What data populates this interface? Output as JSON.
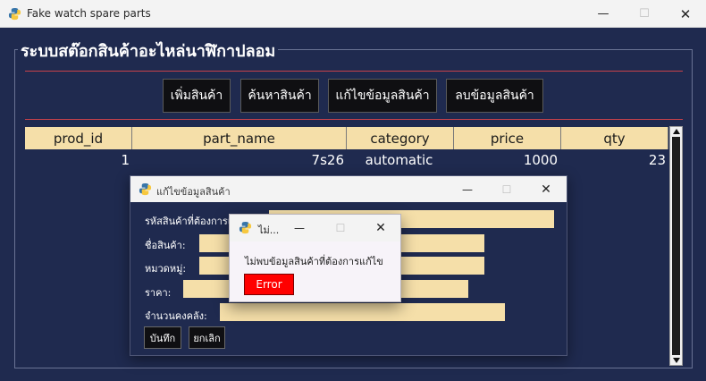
{
  "window": {
    "title": "Fake watch spare parts",
    "icon": "python-icon",
    "controls": {
      "minimize": "—",
      "maximize": "☐",
      "close": "✕"
    }
  },
  "frame": {
    "title": "ระบบสต๊อกสินค้าอะไหล่นาฬิกาปลอม"
  },
  "toolbar": {
    "add_label": "เพิ่มสินค้า",
    "search_label": "ค้นหาสินค้า",
    "edit_label": "แก้ไขข้อมูลสินค้า",
    "delete_label": "ลบข้อมูลสินค้า"
  },
  "table": {
    "columns": [
      "prod_id",
      "part_name",
      "category",
      "price",
      "qty"
    ],
    "rows": [
      [
        "1",
        "7s26",
        "automatic",
        "1000",
        "23"
      ]
    ]
  },
  "edit_dialog": {
    "title": "แก้ไขข้อมูลสินค้า",
    "fields": {
      "prod_code_label": "รหัสสินค้าที่ต้องการแก้ไข:",
      "name_label": "ชื่อสินค้า:",
      "category_label": "หมวดหมู่:",
      "price_label": "ราคา:",
      "qty_label": "จำนวนคงคลัง:"
    },
    "save_label": "บันทึก",
    "cancel_label": "ยกเลิก"
  },
  "error_dialog": {
    "title": "ไม่...",
    "message": "ไม่พบข้อมูลสินค้าที่ต้องการแก้ไข",
    "button_label": "Error"
  },
  "colors": {
    "background": "#1f2a4f",
    "header_fill": "#f5dfa9",
    "accent_red": "#c8424a",
    "error_button": "#ff0000"
  }
}
